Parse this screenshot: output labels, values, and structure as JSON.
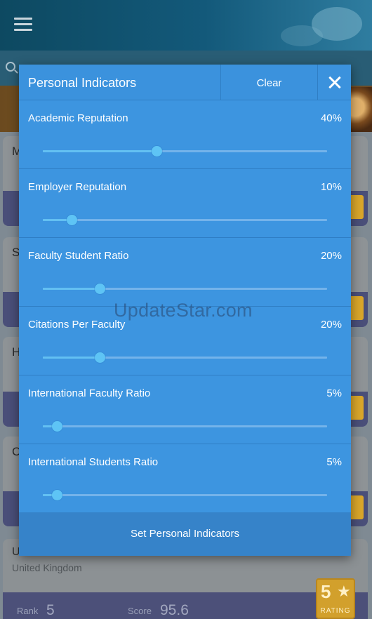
{
  "background": {
    "last_card": {
      "title": "U",
      "country": "United Kingdom",
      "rank_label": "Rank",
      "rank_value": "5",
      "score_label": "Score",
      "score_value": "95.6",
      "rating_number": "5",
      "rating_label": "RATING"
    },
    "card_letters": [
      "M",
      "S",
      "H",
      "C"
    ]
  },
  "dialog": {
    "title": "Personal Indicators",
    "clear_label": "Clear",
    "close_icon": "close-icon",
    "footer_label": "Set Personal Indicators",
    "indicators": [
      {
        "label": "Academic Reputation",
        "value_text": "40%",
        "value": 40
      },
      {
        "label": "Employer Reputation",
        "value_text": "10%",
        "value": 10
      },
      {
        "label": "Faculty Student Ratio",
        "value_text": "20%",
        "value": 20
      },
      {
        "label": "Citations Per Faculty",
        "value_text": "20%",
        "value": 20
      },
      {
        "label": "International Faculty Ratio",
        "value_text": "5%",
        "value": 5
      },
      {
        "label": "International Students Ratio",
        "value_text": "5%",
        "value": 5
      }
    ]
  },
  "watermark": "UpdateStar.com",
  "colors": {
    "dialog_bg": "#3d95e0",
    "footer_bg": "#3683c9",
    "slider_thumb": "#5ec4f5"
  }
}
